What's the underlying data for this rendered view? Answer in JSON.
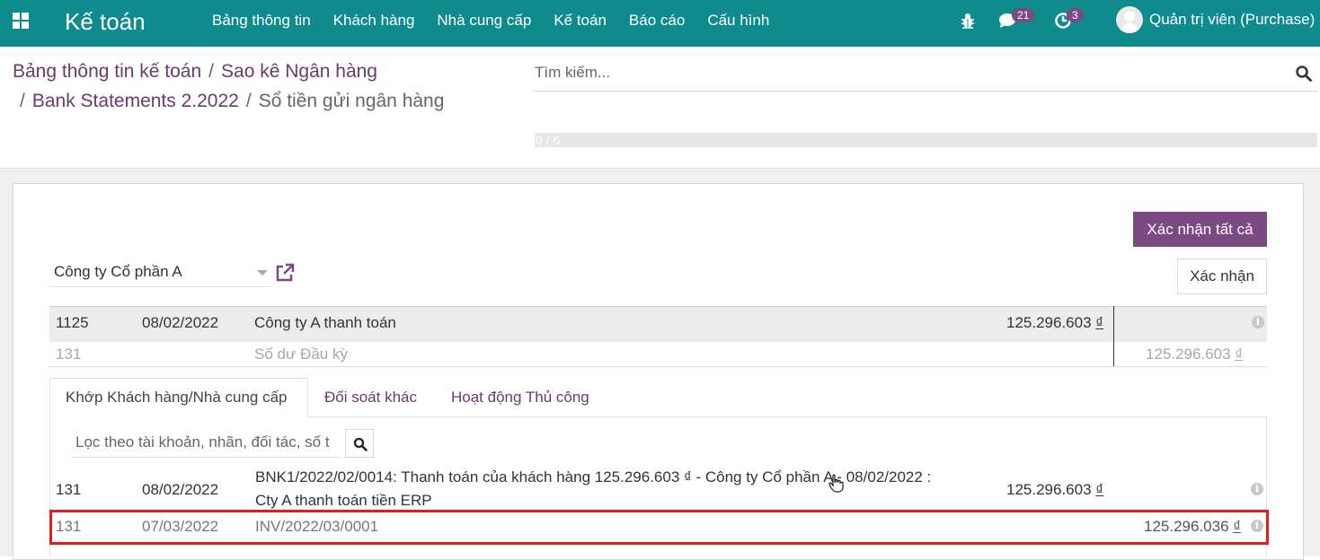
{
  "navbar": {
    "app_title": "Kế toán",
    "menu": [
      "Bảng thông tin",
      "Khách hàng",
      "Nhà cung cấp",
      "Kế toán",
      "Báo cáo",
      "Cấu hình"
    ],
    "messages_count": "21",
    "activities_count": "3",
    "user_name": "Quản trị viên (Purchase)",
    "color": "#0f8b8d"
  },
  "breadcrumb": {
    "item1": "Bảng thông tin kế toán",
    "item2": "Sao kê Ngân hàng",
    "item3": "Bank Statements 2.2022",
    "current": "Sổ tiền gửi ngân hàng",
    "separator": "/"
  },
  "search": {
    "placeholder": "Tìm kiếm..."
  },
  "progress": {
    "text": "0 / 6",
    "done": 0,
    "total": 6
  },
  "actions": {
    "validate_all": "Xác nhận tất cả",
    "validate": "Xác nhận",
    "primary_color": "#7c4a82"
  },
  "partner": {
    "value": "Công ty Cổ phần A"
  },
  "statement_line": {
    "account": "1125",
    "date": "08/02/2022",
    "label": "Công ty A thanh toán",
    "amount": "125.296.603",
    "currency": "₫"
  },
  "open_balance": {
    "account": "131",
    "label": "Số dư Đầu kỳ",
    "amount": "125.296.603",
    "currency": "₫"
  },
  "tabs": [
    "Khớp Khách hàng/Nhà cung cấp",
    "Đối soát khác",
    "Hoạt động Thủ công"
  ],
  "filter": {
    "placeholder": "Lọc theo tài khoản, nhãn, đối tác, số t"
  },
  "move_lines": [
    {
      "account": "131",
      "date": "08/02/2022",
      "label_line1": "BNK1/2022/02/0014: Thanh toán của khách hàng 125.296.603 ₫ - Công ty Cổ phần A - 08/02/2022 :",
      "label_line2": "Cty A thanh toán tiền ERP",
      "debit": "125.296.603",
      "currency": "₫"
    },
    {
      "account": "131",
      "date": "07/03/2022",
      "label": "INV/2022/03/0001",
      "credit": "125.296.036",
      "currency": "₫",
      "highlight_color": "#e01e1e"
    }
  ]
}
